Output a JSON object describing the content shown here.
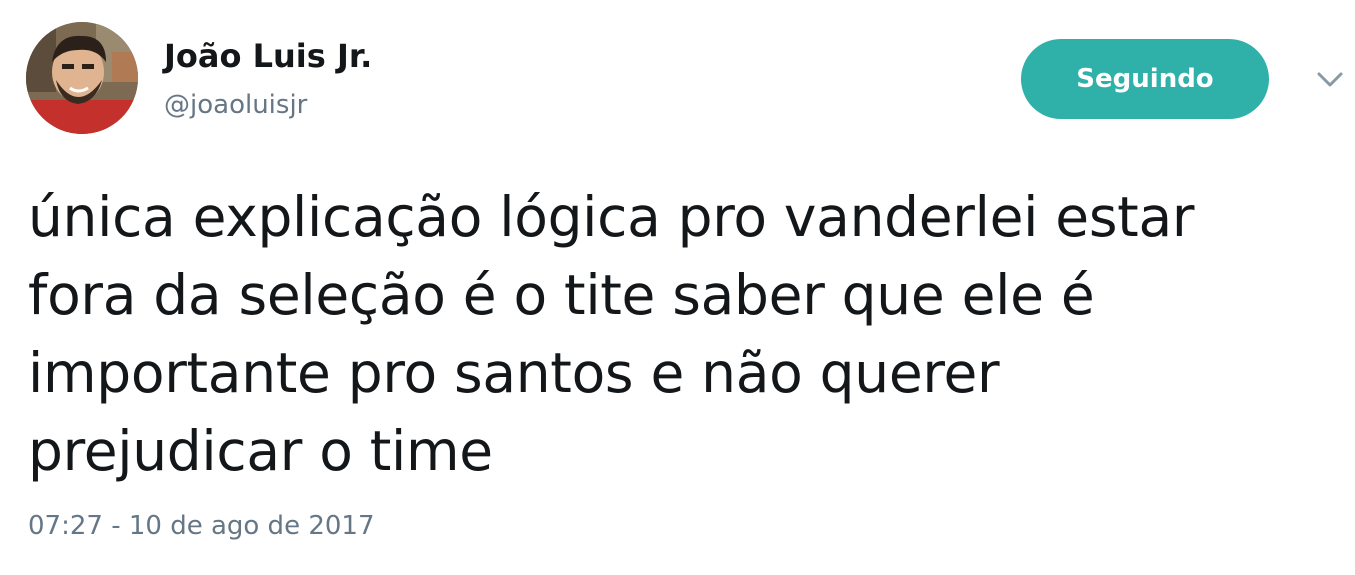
{
  "user": {
    "display_name": "João Luis Jr.",
    "handle": "@joaoluisjr"
  },
  "follow_button": {
    "label": "Seguindo",
    "color": "#2fb0a8"
  },
  "tweet": {
    "lines": [
      "única explicação lógica pro vanderlei estar",
      "fora da seleção é o tite saber que ele é",
      "importante pro santos e não querer",
      "prejudicar o time"
    ],
    "timestamp": "07:27 - 10 de ago de 2017"
  },
  "icons": {
    "avatar": "avatar-photo",
    "menu": "chevron-down-icon"
  },
  "colors": {
    "text": "#14171a",
    "secondary": "#657786"
  }
}
